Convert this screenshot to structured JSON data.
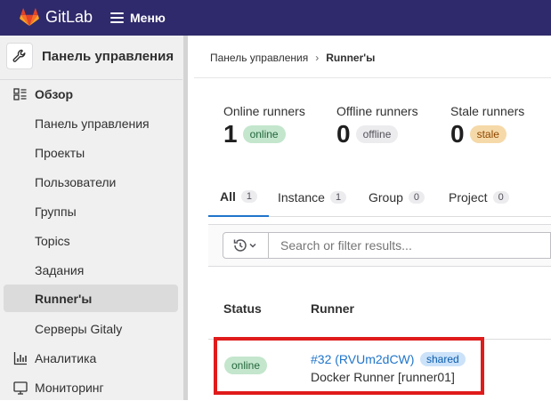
{
  "topbar": {
    "brand": "GitLab",
    "menu_label": "Меню"
  },
  "sidebar": {
    "header": "Панель управления",
    "items": [
      {
        "label": "Обзор",
        "type": "section",
        "icon": "overview-icon"
      },
      {
        "label": "Панель управления"
      },
      {
        "label": "Проекты"
      },
      {
        "label": "Пользователи"
      },
      {
        "label": "Группы"
      },
      {
        "label": "Topics"
      },
      {
        "label": "Задания"
      },
      {
        "label": "Runner'ы",
        "active": true
      },
      {
        "label": "Серверы Gitaly"
      },
      {
        "label": "Аналитика",
        "type": "section",
        "icon": "chart-icon"
      },
      {
        "label": "Мониторинг",
        "type": "section",
        "icon": "monitor-icon"
      }
    ]
  },
  "breadcrumb": {
    "root": "Панель управления",
    "current": "Runner'ы"
  },
  "stats": {
    "online": {
      "label": "Online runners",
      "count": "1",
      "badge": "online"
    },
    "offline": {
      "label": "Offline runners",
      "count": "0",
      "badge": "offline"
    },
    "stale": {
      "label": "Stale runners",
      "count": "0",
      "badge": "stale"
    }
  },
  "tabs": [
    {
      "label": "All",
      "count": "1"
    },
    {
      "label": "Instance",
      "count": "1"
    },
    {
      "label": "Group",
      "count": "0"
    },
    {
      "label": "Project",
      "count": "0"
    }
  ],
  "search": {
    "placeholder": "Search or filter results..."
  },
  "table": {
    "headers": {
      "status": "Status",
      "runner": "Runner"
    },
    "rows": [
      {
        "status": "online",
        "id": "#32 (RVUm2dCW)",
        "tag": "shared",
        "description": "Docker Runner [runner01]"
      }
    ]
  },
  "colors": {
    "topbar": "#2f2a6b",
    "link": "#1f75cb",
    "highlight": "#e01b1b"
  }
}
